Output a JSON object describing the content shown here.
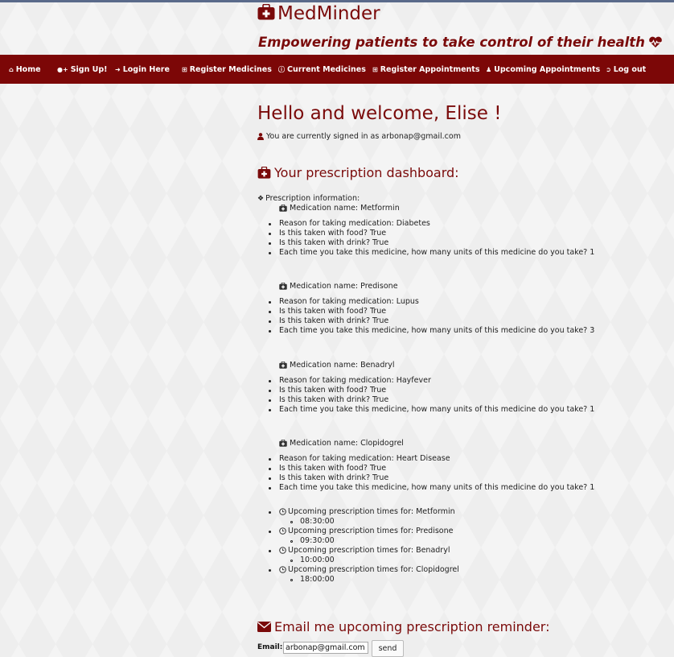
{
  "brand": {
    "name": "MedMinder",
    "tagline": "Empowering patients to take control of their health"
  },
  "nav": [
    {
      "label": "Home",
      "icon": "home-icon"
    },
    {
      "label": "Sign Up!",
      "icon": "add-user-icon"
    },
    {
      "label": "Login Here",
      "icon": "login-icon"
    },
    {
      "label": "Register Medicines",
      "icon": "plus-square-icon"
    },
    {
      "label": "Current Medicines",
      "icon": "info-icon"
    },
    {
      "label": "Register Appointments",
      "icon": "plus-square-icon"
    },
    {
      "label": "Upcoming Appointments",
      "icon": "user-md-icon"
    },
    {
      "label": "Log out",
      "icon": "logout-icon"
    }
  ],
  "welcome": {
    "heading": "Hello and welcome, Elise !",
    "signed_in": "You are currently signed in as arbonap@gmail.com"
  },
  "dashboard": {
    "heading": "Your prescription dashboard:",
    "info_label": "Prescription information:",
    "medications": [
      {
        "name": "Medication name: Metformin",
        "details": [
          "Reason for taking medication: Diabetes",
          "Is this taken with food? True",
          "Is this taken with drink? True",
          "Each time you take this medicine, how many units of this medicine do you take? 1"
        ]
      },
      {
        "name": "Medication name: Predisone",
        "details": [
          "Reason for taking medication: Lupus",
          "Is this taken with food? True",
          "Is this taken with drink? True",
          "Each time you take this medicine, how many units of this medicine do you take? 3"
        ]
      },
      {
        "name": "Medication name: Benadryl",
        "details": [
          "Reason for taking medication: Hayfever",
          "Is this taken with food? True",
          "Is this taken with drink? True",
          "Each time you take this medicine, how many units of this medicine do you take? 1"
        ]
      },
      {
        "name": "Medication name: Clopidogrel",
        "details": [
          "Reason for taking medication: Heart Disease",
          "Is this taken with food? True",
          "Is this taken with drink? True",
          "Each time you take this medicine, how many units of this medicine do you take? 1"
        ]
      }
    ],
    "upcoming": [
      {
        "label": "Upcoming prescription times for: Metformin",
        "time": "08:30:00"
      },
      {
        "label": "Upcoming prescription times for: Predisone",
        "time": "09:30:00"
      },
      {
        "label": "Upcoming prescription times for: Benadryl",
        "time": "10:00:00"
      },
      {
        "label": "Upcoming prescription times for: Clopidogrel",
        "time": "18:00:00"
      }
    ]
  },
  "reminder": {
    "heading": "Email me upcoming prescription reminder:",
    "email_label": "Email:",
    "email_value": "arbonap@gmail.com",
    "send_label": "send"
  },
  "colors": {
    "accent": "#7a0a0a",
    "nav_bg": "#7c0707"
  }
}
